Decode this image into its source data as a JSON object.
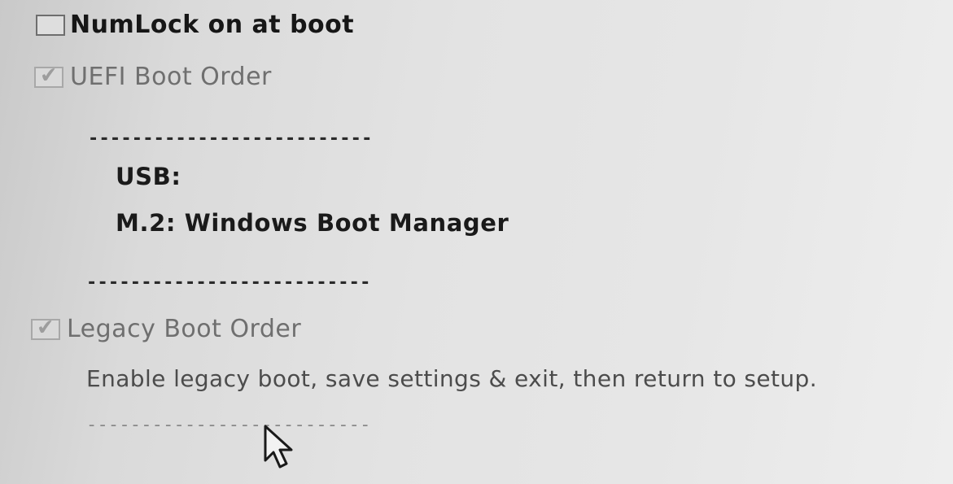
{
  "options": {
    "numlock": {
      "label": "NumLock on at boot",
      "checked": false,
      "enabled": true
    },
    "uefi": {
      "label": "UEFI Boot Order",
      "checked": true,
      "enabled": false
    },
    "legacy": {
      "label": "Legacy Boot Order",
      "checked": true,
      "enabled": false
    }
  },
  "uefi_list": {
    "separator_top": "--------------------------",
    "items": [
      {
        "label": "USB:"
      },
      {
        "label": "M.2:  Windows Boot Manager"
      }
    ],
    "separator_bottom": "--------------------------"
  },
  "legacy_section": {
    "note": "Enable legacy boot, save settings & exit, then return to setup.",
    "separator": "--------------------------"
  },
  "colors": {
    "background": "#e4e4e4",
    "text": "#1c1c1c",
    "disabled_text": "#6f6f6f"
  },
  "icons": {
    "checkbox_checked": "check-mark",
    "pointer": "mouse-cursor"
  }
}
